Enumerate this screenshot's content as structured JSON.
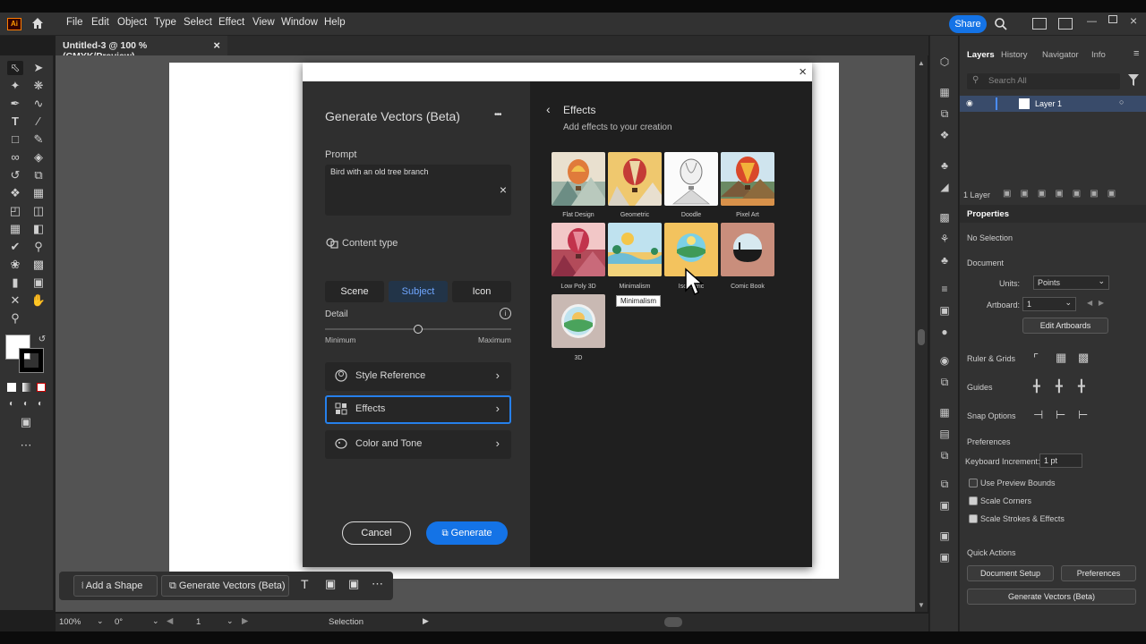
{
  "app": {
    "logo_text": "Ai",
    "menu": [
      "File",
      "Edit",
      "Object",
      "Type",
      "Select",
      "Effect",
      "View",
      "Window",
      "Help"
    ],
    "share_label": "Share",
    "doc_tab": "Untitled-3 @ 100 % (CMYK/Preview)",
    "doc_tab_close": "×"
  },
  "dialog": {
    "close": "×",
    "title": "Generate Vectors (Beta)",
    "more": "•••",
    "prompt_label": "Prompt",
    "prompt_value": "Bird with an old tree branch",
    "prompt_clear": "×",
    "content_type_label": "Content type",
    "content_types": [
      "Scene",
      "Subject",
      "Icon"
    ],
    "selected_content_type": "Subject",
    "detail_label": "Detail",
    "detail_min": "Minimum",
    "detail_max": "Maximum",
    "detail_value": 0.5,
    "options": [
      "Style Reference",
      "Effects",
      "Color and Tone"
    ],
    "cancel_label": "Cancel",
    "generate_label": "Generate",
    "effects_title": "Effects",
    "effects_subtitle": "Add effects to your creation",
    "effects": [
      "Flat Design",
      "Geometric",
      "Doodle",
      "Pixel Art",
      "Low Poly 3D",
      "Minimalism",
      "Isometric",
      "Comic Book",
      "3D"
    ],
    "tooltip": "Minimalism"
  },
  "taskbar": {
    "add_shape": "Add a Shape",
    "generate_vectors": "Generate Vectors (Beta)"
  },
  "status": {
    "zoom": "100%",
    "rotation": "0°",
    "artboard": "1",
    "tool": "Selection"
  },
  "panel": {
    "tabs": [
      "Layers",
      "History",
      "Navigator",
      "Info"
    ],
    "search_placeholder": "Search All",
    "layer_name": "Layer 1",
    "layer_count": "1 Layer",
    "properties_title": "Properties",
    "no_selection": "No Selection",
    "document_label": "Document",
    "units_label": "Units:",
    "units_value": "Points",
    "artboard_label": "Artboard:",
    "artboard_value": "1",
    "edit_artboards": "Edit Artboards",
    "rulers_grids": "Ruler & Grids",
    "guides": "Guides",
    "snap_options": "Snap Options",
    "preferences_label": "Preferences",
    "keyboard_increment_label": "Keyboard Increment:",
    "keyboard_increment_value": "1 pt",
    "use_preview_bounds": "Use Preview Bounds",
    "scale_corners": "Scale Corners",
    "scale_strokes": "Scale Strokes & Effects",
    "quick_actions": "Quick Actions",
    "document_setup": "Document Setup",
    "preferences_btn": "Preferences",
    "generate_vectors_btn": "Generate Vectors (Beta)"
  },
  "colors": {
    "accent_blue": "#1473e6",
    "selection_blue": "#2680eb",
    "layer_row": "#394b6a"
  }
}
